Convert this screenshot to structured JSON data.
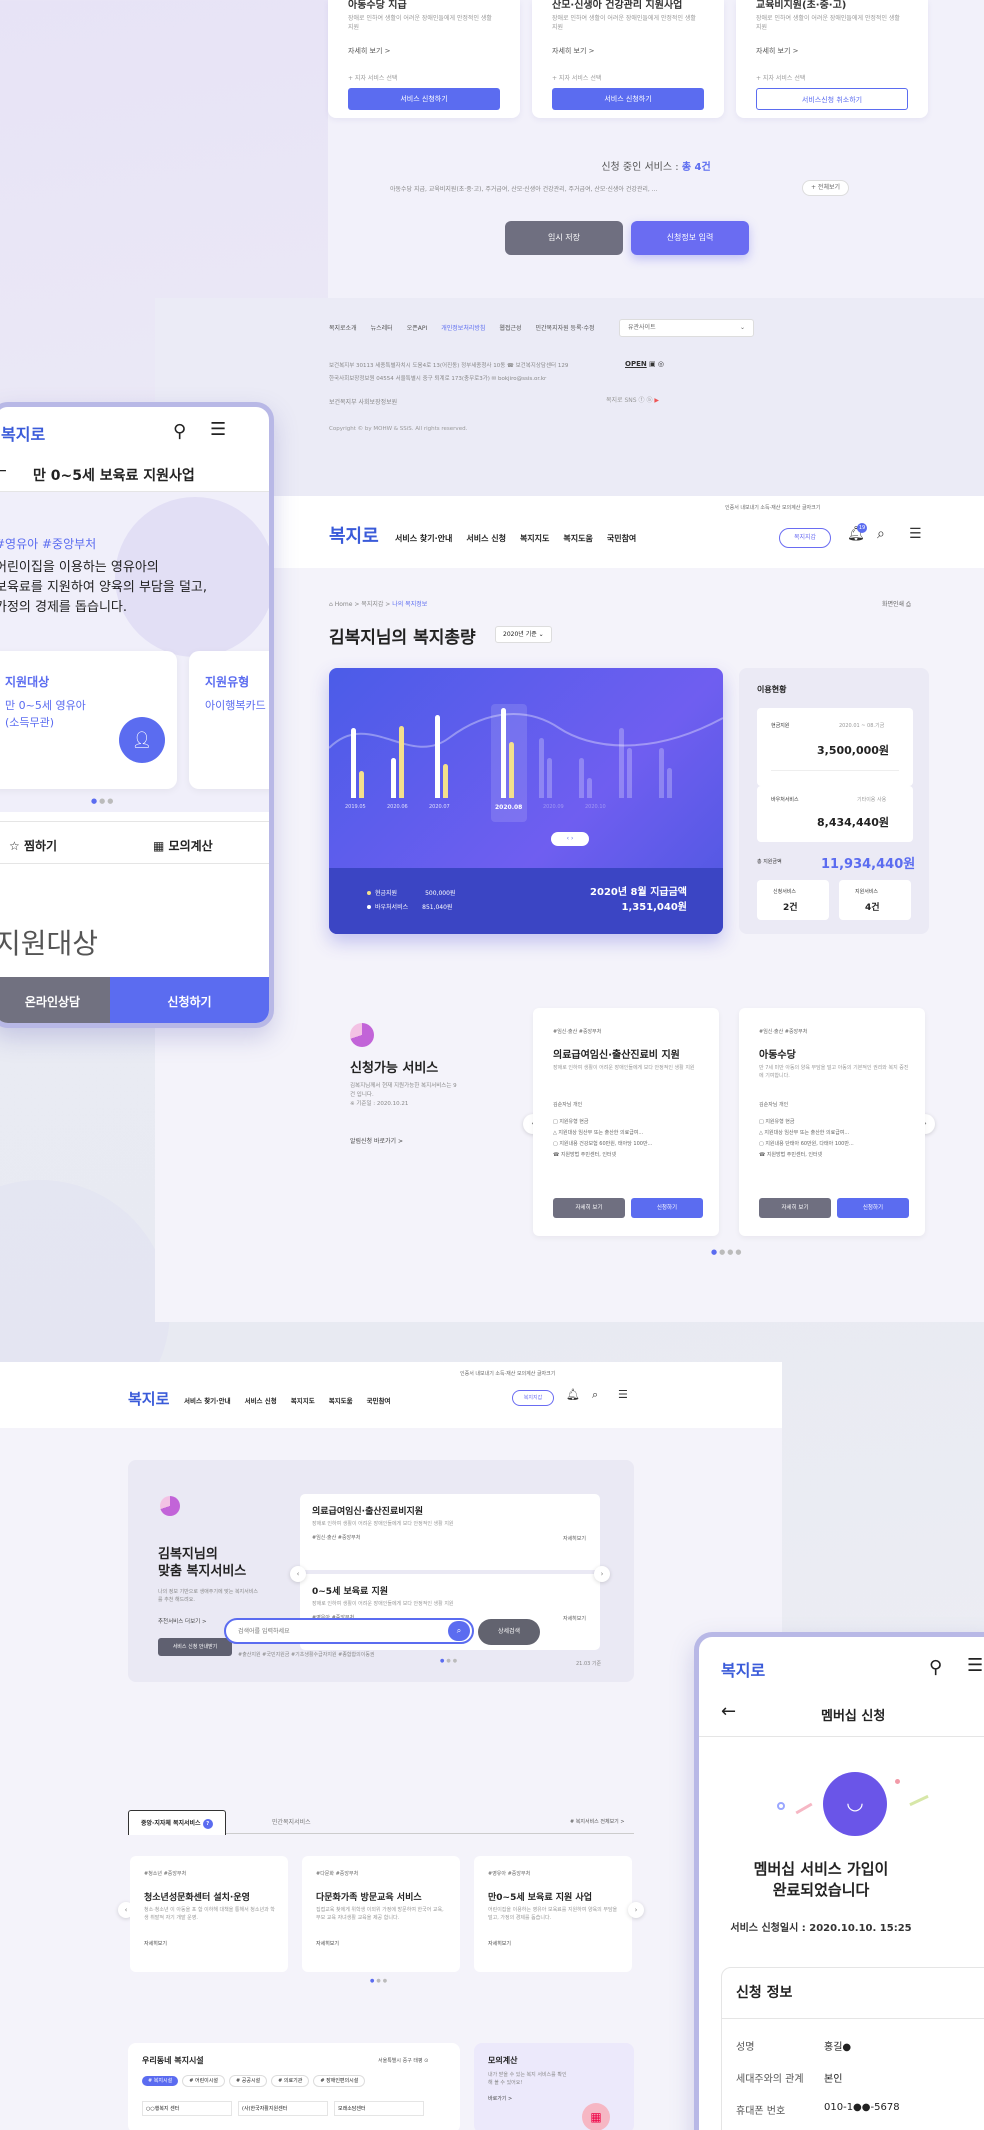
{
  "panel_top": {
    "cards": [
      {
        "title": "아동수당 지급",
        "desc": "장애로 인하여 생활이 어려운 장애인들에게 안정적인 생활 지원",
        "more": "자세히 보기 >",
        "check": "+ 지자 서비스 선택",
        "button": "서비스 신청하기"
      },
      {
        "title": "산모·신생아 건강관리 지원사업",
        "desc": "장애로 인하여 생활이 어려운 장애인들에게 안정적인 생활 지원",
        "more": "자세히 보기 >",
        "check": "+ 지자 서비스 선택",
        "button": "서비스 신청하기"
      },
      {
        "title": "교육비지원(초·중·고)",
        "desc": "장애로 인하여 생활이 어려운 장애인들에게 안정적인 생활 지원",
        "more": "자세히 보기 >",
        "check": "+ 지자 서비스 선택",
        "button": "서비스신청 취소하기"
      }
    ],
    "progress_label": "신청 중인 서비스 : ",
    "progress_count": "총 4건",
    "progress_list": "아동수당 지급,   교육비지원(초·중·고),   주거급여,   산모·신생아 건강관리,   주거급여,   산모·신생아 건강관리, ...",
    "view_all": "+ 전체보기",
    "temp_save": "임시 저장",
    "enter_info": "신청정보 입력"
  },
  "footer": {
    "links": [
      "복지로소개",
      "뉴스레터",
      "오픈API",
      "개인정보처리방침",
      "웹접근성",
      "민간복지자원 등록·수정"
    ],
    "highlight_index": 3,
    "family_site": "유관사이트",
    "address1": "보건복지부      30113 세종특별자치시 도움4로 13(어진동) 정부세종청사 10동  ☎ 보건복지상담센터 129",
    "address2": "한국사회보장정보원      04554 서울특별시 중구 퇴계로 173(충무로3가)  ✉ bokjiro@ssis.or.kr",
    "logos": "보건복지부    사회보장정보원",
    "copyright": "Copyright © by MOHW & SSiS. All rights reserved.",
    "open_badge": "OPEN",
    "social_label": "복지로 SNS"
  },
  "header": {
    "logo": "복지로",
    "nav": [
      "서비스 찾기·안내",
      "서비스 신청",
      "복지지도",
      "복지도움",
      "국민참여"
    ],
    "util": "인증서 내보내기   소득·재산   모의계산   글자크기",
    "my_button": "복지지갑",
    "badge_count": "19"
  },
  "dashboard": {
    "breadcrumb_home": "Home",
    "breadcrumb_mid": "복지지갑",
    "breadcrumb_current": "나의 복지정보",
    "print": "화면인쇄",
    "title": "김복지님의 복지총량",
    "year_select": "2020년 기준",
    "chart_data": {
      "type": "bar",
      "categories": [
        "2019.05",
        "2020.06",
        "2020.07",
        "2020.08"
      ],
      "series": [
        {
          "name": "현금지원",
          "values": [
            0.78,
            0.45,
            0.92,
            1.0
          ]
        },
        {
          "name": "바우처서비스",
          "values": [
            0.3,
            0.8,
            0.38,
            0.62
          ]
        }
      ],
      "x_labels": [
        "2019.05",
        "2020.06",
        "2020.07",
        "2020.08",
        "2020.09",
        "2020.10"
      ],
      "selected": "2020.08"
    },
    "legend": [
      {
        "label": "현금지원",
        "value": "500,000원"
      },
      {
        "label": "바우처서비스",
        "value": "851,040원"
      }
    ],
    "total_label": "2020년 8월 지급금액",
    "total_value": "1,351,040원",
    "usage": {
      "title": "이용현황",
      "cash_label": "현금지원",
      "cash_period": "2020.01 ~ 08.기금",
      "cash_value": "3,500,000원",
      "voucher_label": "바우처서비스",
      "voucher_period": "기타이용 사용",
      "voucher_value": "8,434,440원",
      "total_label": "총 지원금액",
      "total_value": "11,934,440원",
      "applied_label": "신청서비스",
      "applied_value": "2건",
      "support_label": "지원서비스",
      "support_value": "4건"
    }
  },
  "available": {
    "title": "신청가능 서비스",
    "desc": "김복지님께서 현재 지원가능한 복지서비스는 9건 입니다.",
    "date": "※ 기준일 : 2020.10.21",
    "more": "알림신청 바로가기 >",
    "cards": [
      {
        "tags": "#임신·출산   #중앙부처",
        "title": "의료급여임신·출산진료비 지원",
        "desc": "장애로 인하여 생활이 어려운 장애인들에게 보다 안정적인 생활 지원",
        "rows": [
          "김순자님   개인",
          "□ 지원유형   현금",
          "△ 지원대상   임산부 또는 출산한 의료급여...",
          "▢ 지원내용   건강보험 60만원, 태아당 100만...",
          "☎ 지원방법   주민센터, 인터넷"
        ],
        "btn_detail": "자세히 보기",
        "btn_apply": "신청하기"
      },
      {
        "tags": "#임신·출산   #중앙부처",
        "title": "아동수당",
        "desc": "만 7세 미만 아동의 양육 부담을 덜고 아동의 기본적인 권리와 복지 증진에 기여합니다.",
        "rows": [
          "김순자님   개인",
          "□ 지원유형   현금",
          "△ 지원대상   임산부 또는 출산한 의료급여...",
          "▢ 지원내용   단태아 60만원, 다태아 100만...",
          "☎ 지원방법   주민센터, 인터넷"
        ],
        "btn_detail": "자세히 보기",
        "btn_apply": "신청하기"
      }
    ]
  },
  "mobile_support": {
    "logo": "복지로",
    "title": "만 0~5세 보육료 지원사업",
    "tags": "#영유아  #중앙부처",
    "intro": [
      "어린이집을 이용하는 영유아의",
      "보육료를 지원하여 양육의 부담을 덜고,",
      "가정의 경제를 돕습니다."
    ],
    "card1_title": "지원대상",
    "card1_desc": [
      "만 0~5세 영유아",
      "(소득무관)"
    ],
    "card2_title": "지원유형",
    "card2_desc": "아이행복카드",
    "bookmark": "찜하기",
    "simulate": "모의계산",
    "section": "지원대상",
    "consult": "온라인상담",
    "apply": "신청하기"
  },
  "home": {
    "banner_title": [
      "김복지님의",
      "맞춤 복지서비스"
    ],
    "banner_desc": "나의 정보 기반으로 생애주기에 맞는 복지서비스를 추천 해드려요.",
    "banner_more": "추천서비스 더보기 >",
    "banner_btn": "서비스 신청 안내받기",
    "reco": [
      {
        "title": "의료급여임신·출산진료비지원",
        "desc": "장애로 인하여 생활이 어려운 장애인들에게 보다 안정적인 생활 지원",
        "tags": "#임신·출산   #중앙부처",
        "more": "자세히보기"
      },
      {
        "title": "0~5세 보육료 지원",
        "desc": "장애로 인하여 생활이 어려운 장애인들에게 보다 안정적인 생활 지원",
        "tags": "#영유아   #중앙부처",
        "more": "자세히보기"
      }
    ],
    "date": "21.03 기준",
    "search_placeholder": "검색어를 입력하세요",
    "search_btn": "상세검색",
    "keywords": "#출산지원   #국민지원금   #기초생활수급자지원   #종합합의이동권",
    "tabs": [
      "중앙·지자체 복지서비스",
      "민간복지서비스"
    ],
    "all": "# 복지서비스 전체보기 >",
    "cards": [
      {
        "tags": "#청소년   #중앙부처",
        "title": "청소년성문화센터 설치·운영",
        "desc": "청소·청소년 이 아동을 포 함 이하해 대책을 통해서 청소년과 학생 취발적 자기 개발 운영.",
        "more": "자세히보기"
      },
      {
        "tags": "#다문화   #중앙부처",
        "title": "다문화가족 방문교육 서비스",
        "desc": "집접교육 찾에게 위학생 이외위 가정에 방문하여 한국어 교육, 부모 교육 자녀생활 교육을 제공 합니다.",
        "more": "자세히보기"
      },
      {
        "tags": "#영유아   #중앙부처",
        "title": "만0~5세 보육료 지원 사업",
        "desc": "어린이집을 이용하는 영유아 보육료를 지원하여 양육의 부담을 덜고, 가정의 경제를 돕습니다.",
        "more": "자세히보기"
      }
    ],
    "local_title": "우리동네 복지시설",
    "local_region": "서울특별시 중구 태평",
    "local_tabs": [
      "# 복지시설",
      "# 어린이시설",
      "# 공공시설",
      "# 의료기관",
      "# 장애인편의시설"
    ],
    "local_items": [
      "○○행복지 센터",
      "(사)한국자활지원센터",
      "모래소담센터"
    ],
    "calc_title": "모의계산",
    "calc_desc": "내가 받을 수 있는 복지 서비스를 확인해 볼 수 있어요!",
    "calc_more": "바로가기 >"
  },
  "mobile_join": {
    "logo": "복지로",
    "title": "멤버십 신청",
    "done": [
      "멤버십 서비스 가입이",
      "완료되었습니다"
    ],
    "date": "서비스 신청일시 : 2020.10.10. 15:25",
    "info_title": "신청 정보",
    "rows": [
      {
        "k": "성명",
        "v": "홍길●"
      },
      {
        "k": "세대주와의 관계",
        "v": "본인"
      },
      {
        "k": "휴대폰 번호",
        "v": "010-1●●-5678"
      }
    ]
  }
}
